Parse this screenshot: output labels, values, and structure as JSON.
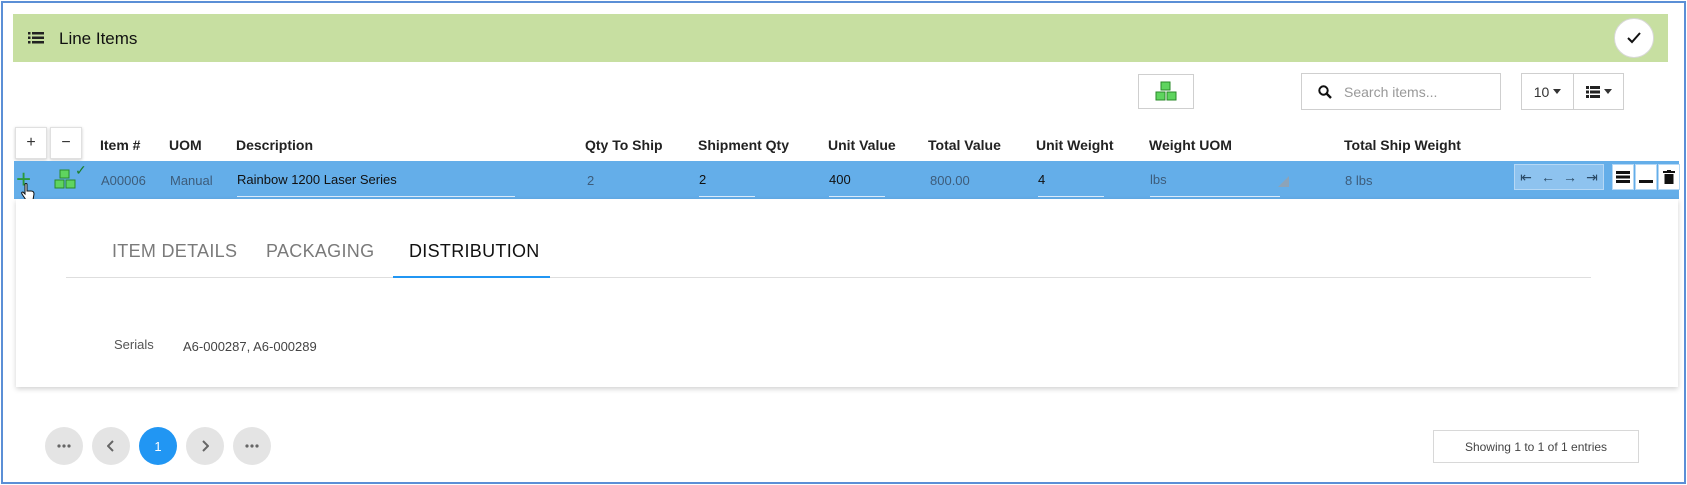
{
  "header": {
    "title": "Line Items"
  },
  "toolbar": {
    "search_placeholder": "Search items...",
    "page_size": "10"
  },
  "table": {
    "expand_all": "+",
    "collapse_all": "−",
    "columns": {
      "item_no": "Item #",
      "uom": "UOM",
      "description": "Description",
      "qty_to_ship": "Qty To Ship",
      "shipment_qty": "Shipment Qty",
      "unit_value": "Unit Value",
      "total_value": "Total Value",
      "unit_weight": "Unit Weight",
      "weight_uom": "Weight UOM",
      "total_ship_weight": "Total Ship Weight"
    },
    "row": {
      "item_no": "A00006",
      "uom": "Manual",
      "description": "Rainbow 1200 Laser Series",
      "qty_to_ship": "2",
      "shipment_qty": "2",
      "unit_value": "400",
      "total_value": "800.00",
      "unit_weight": "4",
      "weight_uom": "lbs",
      "total_ship_weight": "8 lbs"
    }
  },
  "detail": {
    "tabs": [
      "ITEM DETAILS",
      "PACKAGING",
      "DISTRIBUTION"
    ],
    "active_tab": "DISTRIBUTION",
    "serials_label": "Serials",
    "serials_value": "A6-000287, A6-000289"
  },
  "pagination": {
    "current_page": "1",
    "entries_text": "Showing 1 to 1 of 1 entries"
  },
  "colors": {
    "header_bg": "#c7dfa1",
    "row_highlight": "#64aee9",
    "accent": "#2196f3"
  },
  "icons": [
    "list-icon",
    "check-icon",
    "package-boxes-icon",
    "search-icon",
    "list-view-icon",
    "plus-icon",
    "hand-cursor-icon",
    "first-icon",
    "prev-icon",
    "next-icon",
    "last-icon",
    "expand-icon",
    "minimize-icon",
    "trash-icon",
    "ellipsis-icon",
    "chevron-left-icon",
    "chevron-right-icon"
  ]
}
